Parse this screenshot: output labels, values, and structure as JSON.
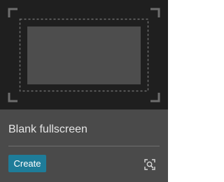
{
  "card": {
    "title": "Blank fullscreen",
    "create_label": "Create",
    "preview_icon": "preview-search-icon"
  },
  "colors": {
    "thumbnail_bg": "#1f1f1f",
    "card_bg": "#4a4a4a",
    "accent": "#1e7c99",
    "title_text": "#e6e6e6"
  }
}
